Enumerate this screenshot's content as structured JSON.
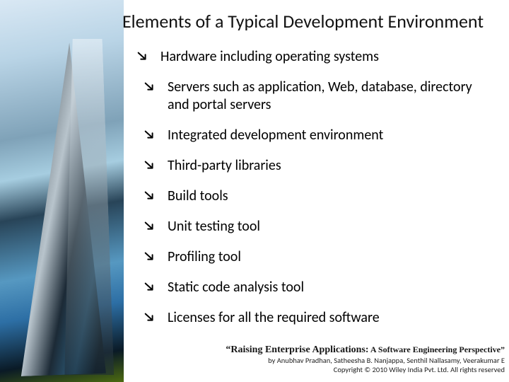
{
  "title": "Elements of a Typical Development Environment",
  "bullets": [
    {
      "text": "Hardware including operating systems",
      "indent": false
    },
    {
      "text": "Servers such as application, Web, database, directory and portal servers",
      "indent": true
    },
    {
      "text": "Integrated development environment",
      "indent": true
    },
    {
      "text": "Third-party libraries",
      "indent": true
    },
    {
      "text": "Build tools",
      "indent": true
    },
    {
      "text": "Unit testing tool",
      "indent": true
    },
    {
      "text": "Profiling tool",
      "indent": true
    },
    {
      "text": "Static code analysis tool",
      "indent": true
    },
    {
      "text": "Licenses for all the required software",
      "indent": true
    }
  ],
  "footer": {
    "book_title": "“Raising Enterprise Applications:",
    "book_subtitle": " A Software Engineering Perspective”",
    "authors": "by Anubhav Pradhan, Satheesha B. Nanjappa, Senthil Nallasamy, Veerakumar E",
    "copyright": "Copyright © 2010 Wiley India Pvt. Ltd.  All rights reserved"
  }
}
